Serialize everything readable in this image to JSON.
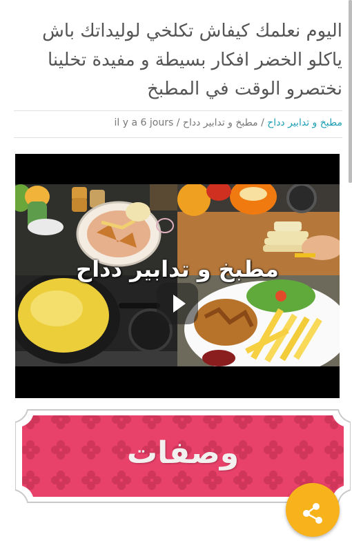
{
  "article": {
    "title": "اليوم نعلمك كيفاش تكلخي لوليداتك باش ياكلو الخضر افكار بسيطة و مفيدة تخلينا نختصرو الوقت في المطبخ"
  },
  "meta": {
    "category_link": "مطبخ و تدابير دداح",
    "separator1": " / ",
    "category_text": "مطبخ و تدابير دداح",
    "separator2": " / ",
    "time": "il y a 6 jours"
  },
  "video": {
    "watermark": "مطبخ و تدابير دداح",
    "play_icon": "play-icon"
  },
  "banner": {
    "label": "وصفات"
  },
  "fab": {
    "icon": "share-icon",
    "color": "#f7b21c"
  },
  "colors": {
    "link": "#1fa0b4",
    "banner_pink": "#e8416a",
    "title_text": "#555555"
  }
}
